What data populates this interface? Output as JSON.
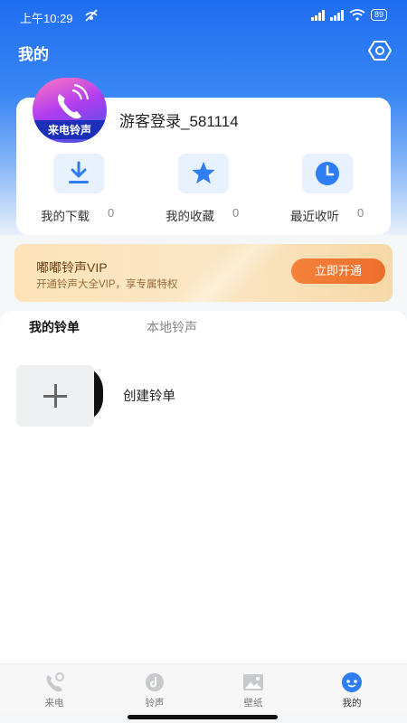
{
  "status_bar": {
    "time": "上午10:29",
    "battery": "89",
    "icons": [
      "mute-icon",
      "hd-signal-icon",
      "hd-signal-icon",
      "wifi-icon",
      "battery-icon"
    ]
  },
  "header": {
    "title": "我的",
    "settings_icon": "settings-hexagon-icon"
  },
  "profile": {
    "avatar_text": "来电铃声",
    "username": "游客登录_581114"
  },
  "quick_actions": [
    {
      "icon": "download-icon",
      "label": "我的下载",
      "count": "0"
    },
    {
      "icon": "star-icon",
      "label": "我的收藏",
      "count": "0"
    },
    {
      "icon": "clock-icon",
      "label": "最近收听",
      "count": "0"
    }
  ],
  "vip": {
    "title": "嘟嘟铃声VIP",
    "subtitle": "开通铃声大全VIP，享专属特权",
    "button": "立即开通"
  },
  "tabs": [
    {
      "label": "我的铃单",
      "active": true
    },
    {
      "label": "本地铃声",
      "active": false
    }
  ],
  "playlist": {
    "create_label": "创建铃单",
    "create_icon": "plus-icon"
  },
  "bottom_nav": [
    {
      "label": "来电",
      "icon": "incoming-call-icon",
      "active": false
    },
    {
      "label": "铃声",
      "icon": "ringtone-icon",
      "active": false
    },
    {
      "label": "壁纸",
      "icon": "wallpaper-icon",
      "active": false
    },
    {
      "label": "我的",
      "icon": "profile-robot-icon",
      "active": true
    }
  ],
  "colors": {
    "primary": "#1e6ef0",
    "icon_blue": "#2f7df3",
    "vip_button": "#f3823a"
  }
}
